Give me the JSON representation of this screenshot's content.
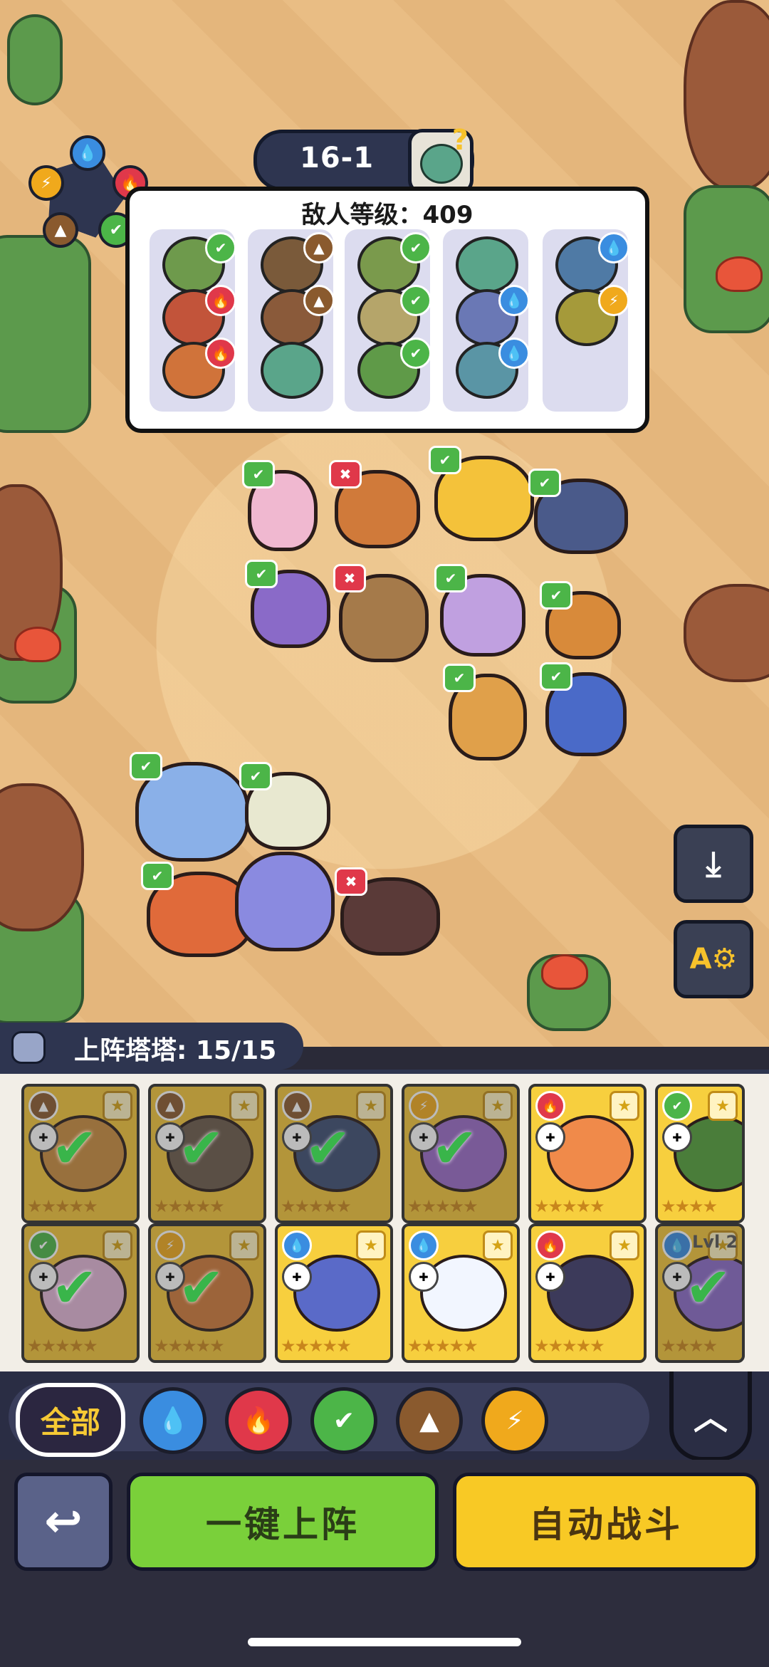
{
  "stage": {
    "level": "16-1"
  },
  "enemy_panel": {
    "label": "敌人等级：409",
    "columns": [
      {
        "enemies": [
          {
            "color": "#6e9a4c",
            "element": "nature"
          },
          {
            "color": "#c2543a",
            "element": "fire"
          },
          {
            "color": "#d0733a",
            "element": "fire"
          }
        ]
      },
      {
        "enemies": [
          {
            "color": "#7a5a3a",
            "element": "earth"
          },
          {
            "color": "#8a5a3a",
            "element": "earth"
          },
          {
            "color": "#5aa58a",
            "element": "none"
          }
        ]
      },
      {
        "enemies": [
          {
            "color": "#7a9a4c",
            "element": "nature"
          },
          {
            "color": "#b5a56a",
            "element": "nature"
          },
          {
            "color": "#5f9a48",
            "element": "nature"
          }
        ]
      },
      {
        "enemies": [
          {
            "color": "#5aa58a",
            "element": "none"
          },
          {
            "color": "#6a78b5",
            "element": "water"
          },
          {
            "color": "#5a95a5",
            "element": "water"
          }
        ]
      },
      {
        "enemies": [
          {
            "color": "#4f7aa5",
            "element": "water"
          },
          {
            "color": "#a59a3a",
            "element": "thunder"
          }
        ]
      }
    ]
  },
  "element_icons": {
    "water": {
      "glyph": "💧",
      "color": "#3a8de0"
    },
    "fire": {
      "glyph": "🔥",
      "color": "#e0384a"
    },
    "nature": {
      "glyph": "✔",
      "color": "#4cb548"
    },
    "earth": {
      "glyph": "▲",
      "color": "#8a5a2e"
    },
    "thunder": {
      "glyph": "⚡",
      "color": "#f0a91c"
    }
  },
  "side_buttons": {
    "download_glyph": "⤓",
    "auto_settings_glyph": "A⚙"
  },
  "tower_count": {
    "label": "上阵塔塔: 15/15"
  },
  "cards_row1": [
    {
      "element": "earth",
      "art": "#c98c3e",
      "bg": "#f3c53a",
      "deployed": true,
      "stars": "★★★★★"
    },
    {
      "element": "earth",
      "art": "#6a5a4a",
      "bg": "#f3c53a",
      "deployed": true,
      "stars": "★★★★★"
    },
    {
      "element": "earth",
      "art": "#3d4d72",
      "bg": "#f3c53a",
      "deployed": true,
      "stars": "★★★★★"
    },
    {
      "element": "thunder",
      "art": "#9a6ac8",
      "bg": "#f3c53a",
      "deployed": true,
      "stars": "★★★★★"
    },
    {
      "element": "fire",
      "art": "#f08a4a",
      "bg": "#f7cf3e",
      "deployed": false,
      "stars": "★★★★★"
    },
    {
      "element": "nature",
      "art": "#4a7d3a",
      "bg": "#f7cf3e",
      "deployed": false,
      "stars": "★★★★"
    }
  ],
  "cards_row2": [
    {
      "element": "nature",
      "art": "#e2b6d8",
      "bg": "#f3c53a",
      "deployed": true,
      "stars": "★★★★★"
    },
    {
      "element": "thunder",
      "art": "#d07a3a",
      "bg": "#f3c53a",
      "deployed": true,
      "stars": "★★★★★"
    },
    {
      "element": "water",
      "art": "#5a6ac8",
      "bg": "#f7cf3e",
      "deployed": false,
      "stars": "★★★★★"
    },
    {
      "element": "water",
      "art": "#f2f6ff",
      "bg": "#f7cf3e",
      "deployed": false,
      "stars": "★★★★★"
    },
    {
      "element": "fire",
      "art": "#3c3a5a",
      "bg": "#f7cf3e",
      "deployed": false,
      "stars": "★★★★★"
    },
    {
      "element": "water",
      "art": "#8a6ac8",
      "bg": "#f3c53a",
      "deployed": true,
      "stars": "★★★★",
      "level_label": "Lvl 2"
    }
  ],
  "filters": {
    "all_label": "全部"
  },
  "bottom": {
    "back_glyph": "↩",
    "one_click_label": "一键上阵",
    "auto_battle_label": "自动战斗"
  }
}
